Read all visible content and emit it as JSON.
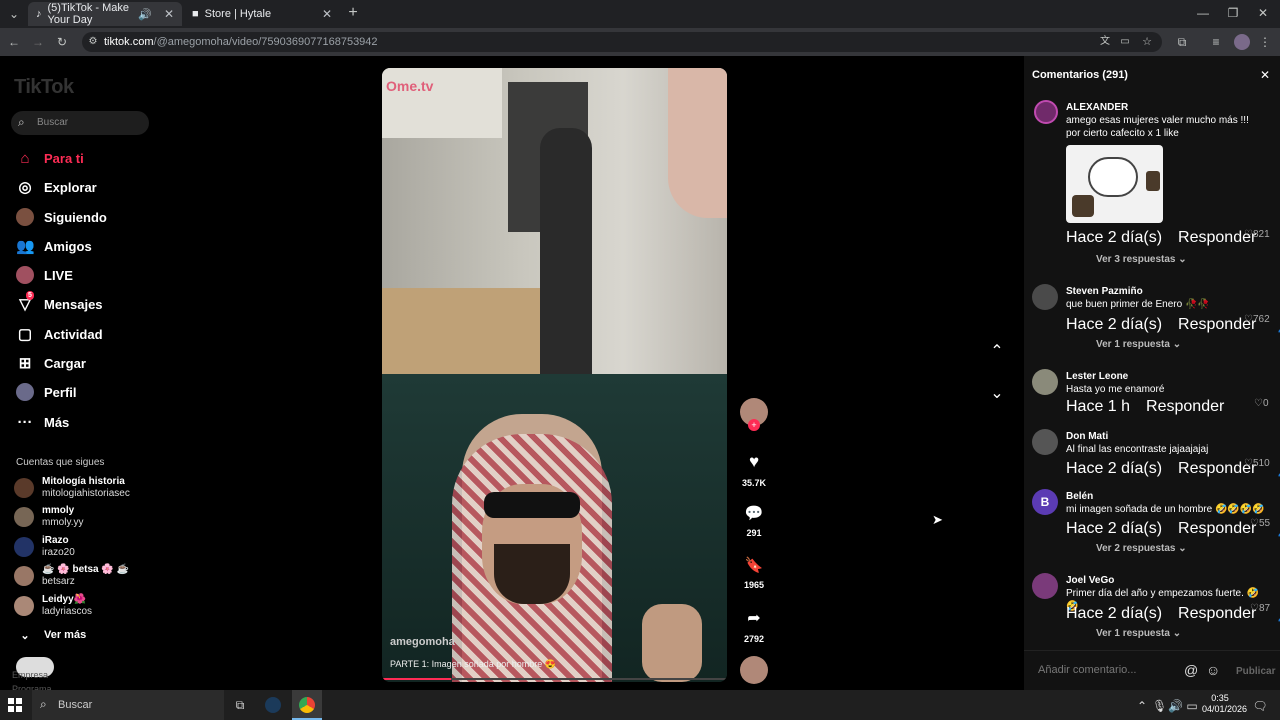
{
  "browser": {
    "tabs": [
      {
        "title": "(5)TikTok - Make Your Day",
        "active": true
      },
      {
        "title": "Store | Hytale",
        "active": false
      }
    ],
    "url_domain": "tiktok.com",
    "url_path": "/@amegomoha/video/7590369077168753942"
  },
  "sidebar": {
    "logo": "TikTok",
    "search_placeholder": "Buscar",
    "nav": [
      {
        "label": "Para ti",
        "icon": "home-icon",
        "active": true
      },
      {
        "label": "Explorar",
        "icon": "compass-icon"
      },
      {
        "label": "Siguiendo",
        "icon": "following-avatar"
      },
      {
        "label": "Amigos",
        "icon": "friends-icon"
      },
      {
        "label": "LIVE",
        "icon": "live-avatar"
      },
      {
        "label": "Mensajes",
        "icon": "messages-icon",
        "badge": "5"
      },
      {
        "label": "Actividad",
        "icon": "activity-icon"
      },
      {
        "label": "Cargar",
        "icon": "upload-icon"
      },
      {
        "label": "Perfil",
        "icon": "profile-avatar"
      },
      {
        "label": "Más",
        "icon": "more-icon"
      }
    ],
    "following_title": "Cuentas que sigues",
    "following": [
      {
        "name": "Mitología historia",
        "user": "mitologiahistoriasec"
      },
      {
        "name": "mmoly",
        "user": "mmoly.yy"
      },
      {
        "name": "iRazo",
        "user": "irazo20"
      },
      {
        "name": "☕ 🌸 betsa 🌸 ☕",
        "user": "betsarz"
      },
      {
        "name": "Leidyy🌺",
        "user": "ladyriascos"
      }
    ],
    "see_more": "Ver más",
    "footer": [
      "Empresa",
      "Programa"
    ]
  },
  "video": {
    "overlay_brand": "Ome.tv",
    "author": "amegomoha",
    "caption": "PARTE 1: Imagen soñada por hombre 😍",
    "likes": "35.7K",
    "comments": "291",
    "saves": "1965",
    "shares": "2792"
  },
  "comments_panel": {
    "title": "Comentarios (291)",
    "input_placeholder": "Añadir comentario...",
    "publish": "Publicar",
    "reply_label": "Responder",
    "items": [
      {
        "name": "ALEXANDER",
        "text": "amego esas mujeres valer mucho más !!!",
        "text2": "por cierto cafecito x 1 like",
        "time": "Hace 2 día(s)",
        "likes": "821",
        "replies": "Ver 3 respuestas"
      },
      {
        "name": "Steven Pazmiño",
        "text": "que buen primer de Enero 🥀🥀",
        "time": "Hace 2 día(s)",
        "likes": "762",
        "replies": "Ver 1 respuesta"
      },
      {
        "name": "Lester Leone",
        "text": "Hasta yo me enamoré",
        "time": "Hace 1 h",
        "likes": "0"
      },
      {
        "name": "Don Mati",
        "text": "Al final las encontraste jajaajajaj",
        "time": "Hace 2 día(s)",
        "likes": "510"
      },
      {
        "name": "Belén",
        "text": "mi imagen soñada de un hombre 🤣🤣🤣🤣",
        "time": "Hace 2 día(s)",
        "likes": "55",
        "replies": "Ver 2 respuestas"
      },
      {
        "name": "Joel VeGo",
        "text": "Primer día del año y empezamos fuerte. 🤣🤣",
        "time": "Hace 2 día(s)",
        "likes": "87",
        "replies": "Ver 1 respuesta"
      }
    ]
  },
  "taskbar": {
    "search": "Buscar",
    "time": "0:35",
    "date": "04/01/2026"
  }
}
